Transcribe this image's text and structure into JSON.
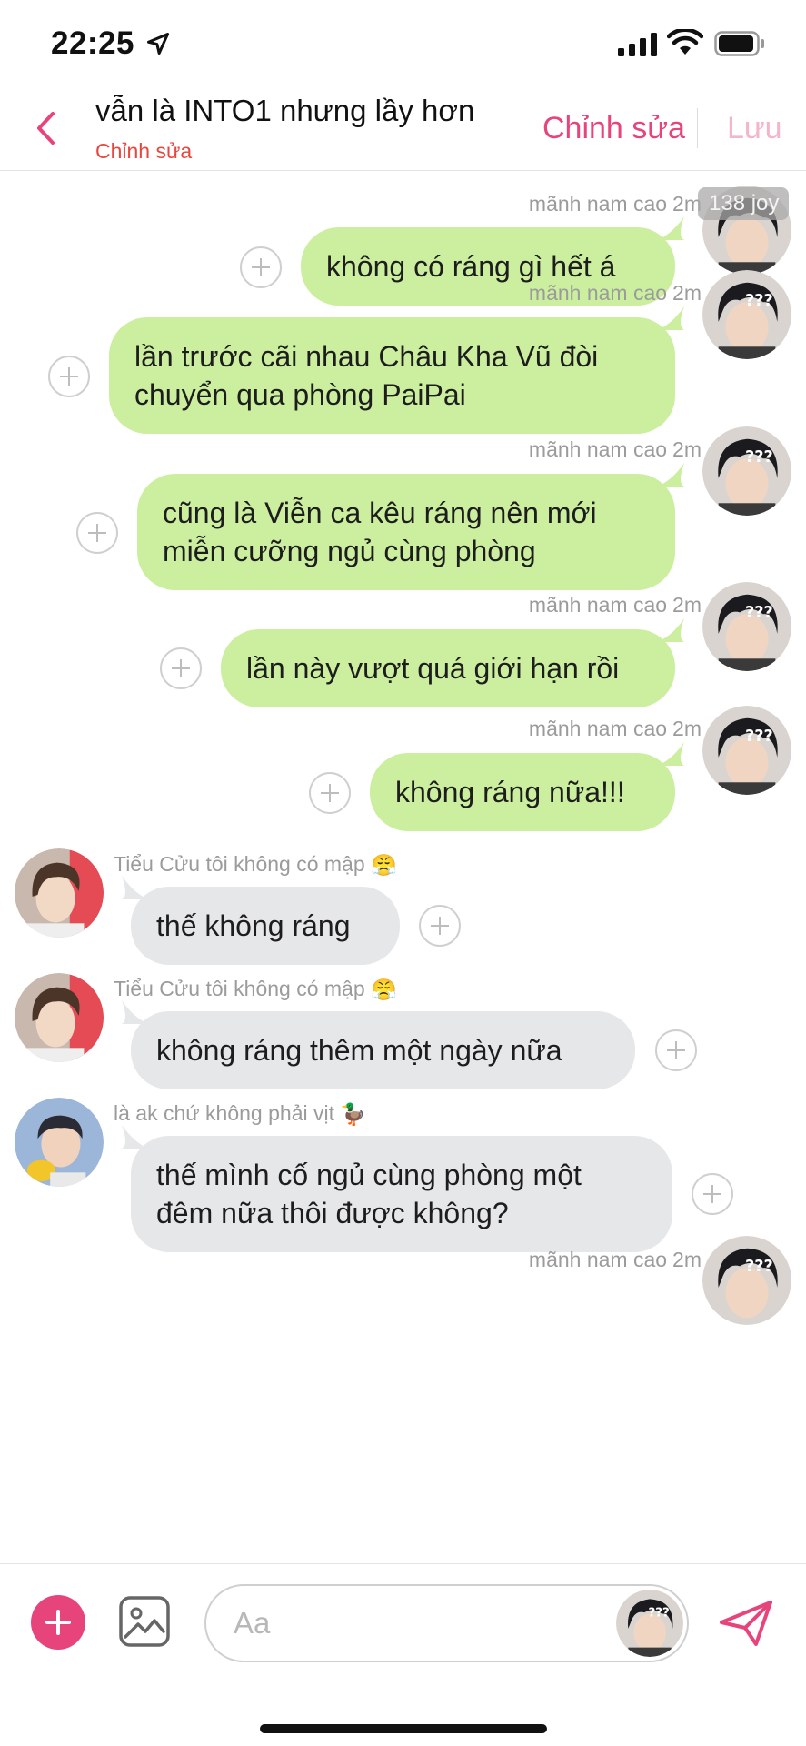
{
  "status_bar": {
    "time": "22:25",
    "icons": [
      "location-arrow-icon",
      "cellular-signal-icon",
      "wifi-icon",
      "battery-icon"
    ]
  },
  "header": {
    "title": "vẫn là INTO1 nhưng lầy hơn",
    "subtitle": "Chỉnh sửa",
    "edit_label": "Chỉnh sửa",
    "save_label": "Lưu",
    "back_icon": "chevron-left-icon",
    "colors": {
      "accent": "#e8447c",
      "subtitle": "#e8463c",
      "disabled": "#f4b5c8"
    }
  },
  "watermark": "138 joy",
  "messages": [
    {
      "direction": "out",
      "sender": "mãnh nam cao",
      "time": "2m",
      "text": "không có ráng gì hết á"
    },
    {
      "direction": "out",
      "sender": "mãnh nam cao",
      "time": "2m",
      "lines": [
        "lần trước cãi nhau Châu Kha Vũ đòi",
        "chuyển qua phòng PaiPai"
      ]
    },
    {
      "direction": "out",
      "sender": "mãnh nam cao",
      "time": "2m",
      "lines": [
        "cũng là Viễn ca kêu ráng nên mới",
        "miễn cưỡng ngủ cùng phòng"
      ]
    },
    {
      "direction": "out",
      "sender": "mãnh nam cao",
      "time": "2m",
      "text": "lần này vượt quá giới hạn rồi"
    },
    {
      "direction": "out",
      "sender": "mãnh nam cao",
      "time": "2m",
      "text": "không ráng nữa!!!"
    },
    {
      "direction": "in",
      "sender": "Tiểu Cửu tôi không có mập",
      "sender_emoji": "😤",
      "text": "thế không ráng"
    },
    {
      "direction": "in",
      "sender": "Tiểu Cửu tôi không có mập",
      "sender_emoji": "😤",
      "text": "không ráng thêm một ngày nữa"
    },
    {
      "direction": "in",
      "sender": "là ak chứ không phải vịt",
      "sender_emoji": "🦆",
      "lines": [
        "thế mình cố ngủ cùng phòng một",
        "đêm nữa thôi được không?"
      ]
    },
    {
      "direction": "out",
      "sender": "mãnh nam cao",
      "time": "2m",
      "text": ""
    }
  ],
  "avatar_caption": "???",
  "composer": {
    "placeholder": "Aa",
    "icons": [
      "plus-icon",
      "image-icon",
      "send-icon"
    ]
  },
  "colors": {
    "outgoing_bubble": "#cbef9f",
    "incoming_bubble": "#e6e7e9",
    "accent": "#e8447c"
  }
}
